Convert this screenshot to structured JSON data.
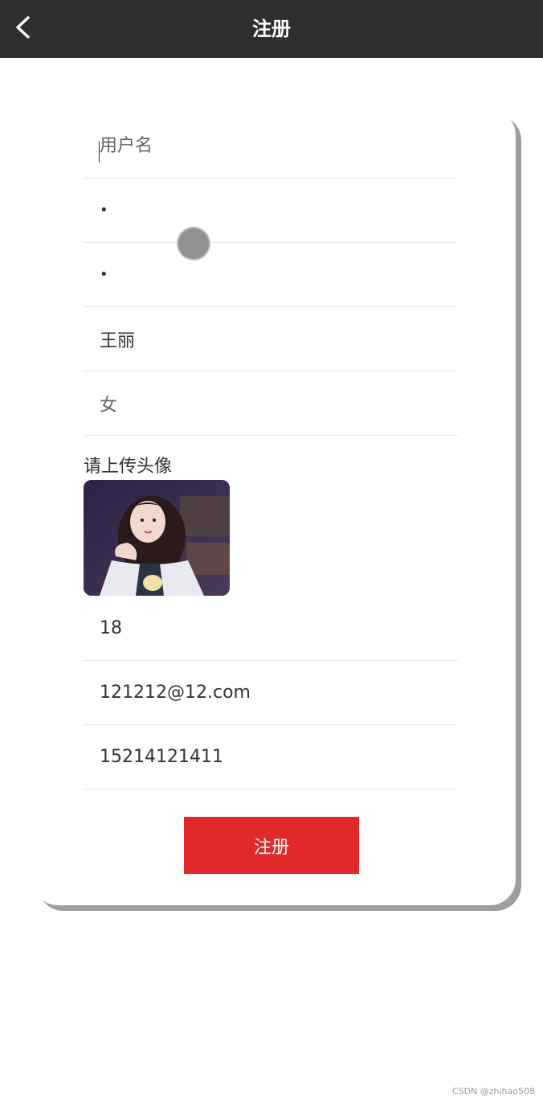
{
  "header": {
    "title": "注册",
    "back_icon": "chevron-left-icon"
  },
  "form": {
    "username": {
      "placeholder": "用户名",
      "value": ""
    },
    "password": {
      "value": "•"
    },
    "confirm_password": {
      "value": "•"
    },
    "realname": {
      "value": "王丽"
    },
    "gender": {
      "value": "女"
    },
    "avatar_label": "请上传头像",
    "age": {
      "value": "18"
    },
    "email": {
      "value": "121212@12.com"
    },
    "phone": {
      "value": "15214121411"
    },
    "submit_label": "注册"
  },
  "colors": {
    "navbar": "#2f2f2f",
    "primary_button": "#e1292b",
    "card_shadow": "#9e9e9e"
  },
  "watermark": "CSDN @zhihao508"
}
